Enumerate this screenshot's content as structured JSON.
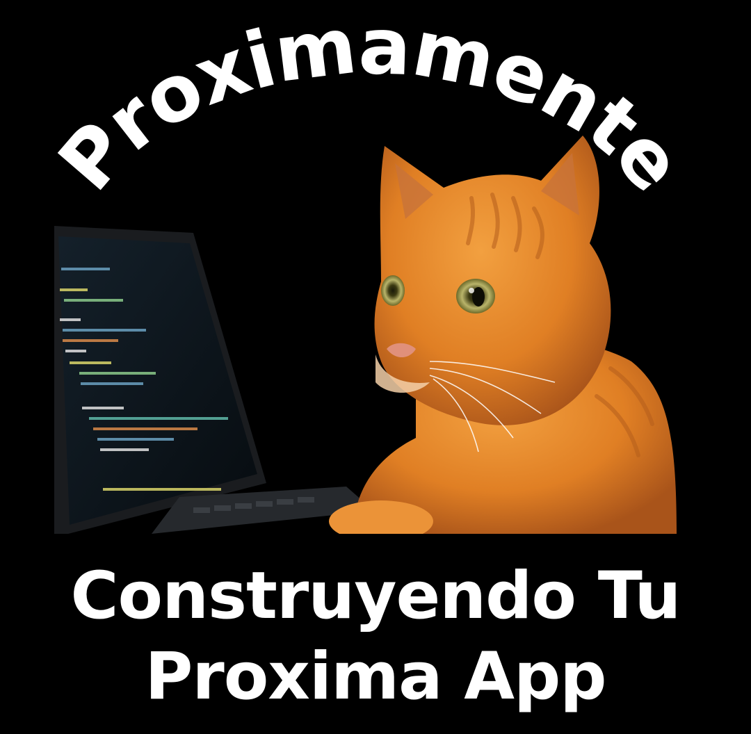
{
  "arc_title": "Proximamente",
  "caption": {
    "line1": "Construyendo Tu",
    "line2": "Proxima App"
  },
  "colors": {
    "background": "#000000",
    "text": "#ffffff",
    "cat_orange": "#e88a2e",
    "screen": "#0d1418"
  }
}
